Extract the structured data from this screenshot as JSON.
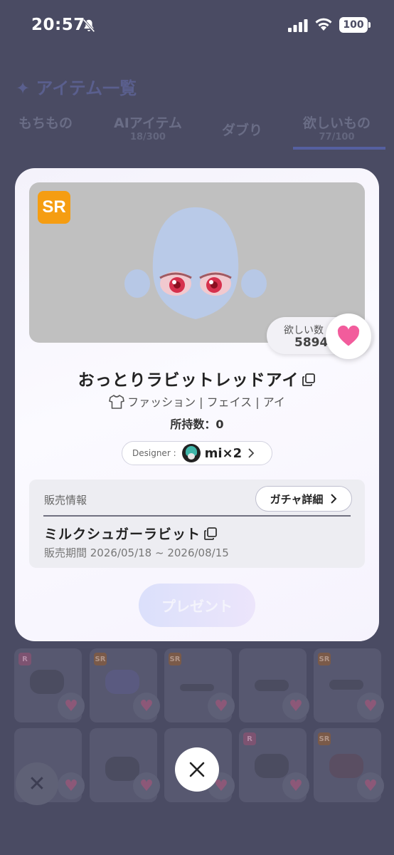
{
  "status_bar": {
    "time": "20:57",
    "battery": "100"
  },
  "background": {
    "title": "アイテム一覧",
    "tabs": [
      {
        "label": "もちもの",
        "sub": ""
      },
      {
        "label": "AIアイテム",
        "sub": "18/300"
      },
      {
        "label": "ダブり",
        "sub": ""
      },
      {
        "label": "欲しいもの",
        "sub": "77/100"
      }
    ],
    "card_badges": [
      "R",
      "SR",
      "SR",
      "",
      "SR",
      "",
      "",
      "",
      "R",
      "SR"
    ]
  },
  "modal": {
    "rarity": "SR",
    "wish_label": "欲しい数",
    "wish_count": "5894",
    "item_name": "おっとりラビットレッドアイ",
    "category": "ファッション | フェイス | アイ",
    "owned": "所持数：0",
    "designer_label": "Designer :",
    "designer_name": "mi×2",
    "sales": {
      "label": "販売情報",
      "gacha_button": "ガチャ詳細",
      "gacha_name": "ミルクシュガーラビット",
      "period": "販売期間 2026/05/18 ~ 2026/08/15"
    },
    "present_button": "プレゼント"
  },
  "colors": {
    "rarity_sr": "#f59d12",
    "heart": "#f25c9c",
    "overlay": "#4a4b63"
  }
}
